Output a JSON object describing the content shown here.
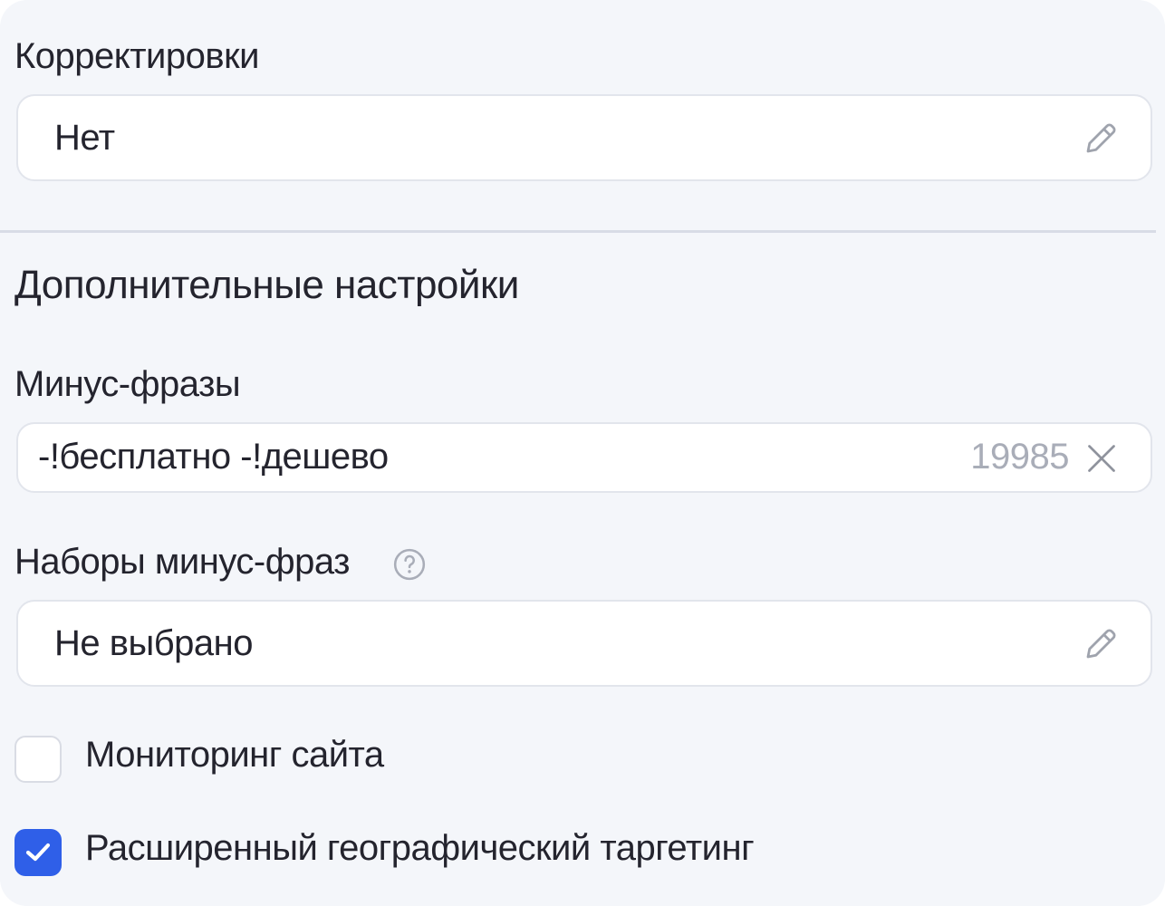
{
  "adjustments": {
    "label": "Корректировки",
    "value": "Нет",
    "edit_icon": "pencil-icon"
  },
  "additional_settings": {
    "title": "Дополнительные настройки"
  },
  "negative_phrases": {
    "label": "Минус-фразы",
    "value": "-!бесплатно -!дешево",
    "counter": "19985",
    "clear_icon": "close-icon"
  },
  "negative_phrase_sets": {
    "label": "Наборы минус-фраз",
    "help_icon": "question-circle-icon",
    "value": "Не выбрано",
    "edit_icon": "pencil-icon"
  },
  "checkboxes": [
    {
      "label": "Мониторинг сайта",
      "checked": false
    },
    {
      "label": "Расширенный географический таргетинг",
      "checked": true
    }
  ],
  "colors": {
    "background": "#f4f6fa",
    "checkbox_accent": "#2f5fe8",
    "muted_text": "#a9adb8"
  }
}
